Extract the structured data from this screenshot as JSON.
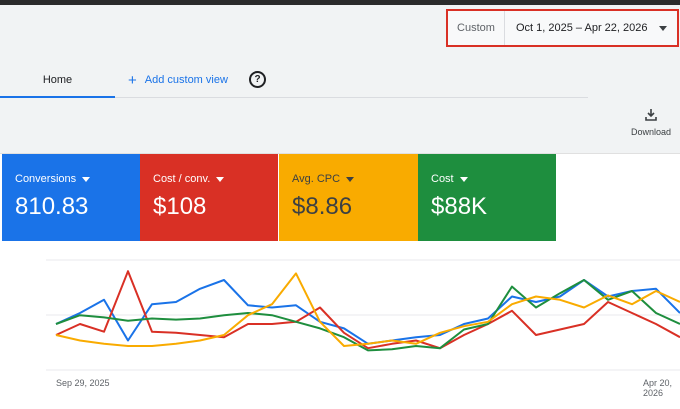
{
  "date_range": {
    "preset": "Custom",
    "range": "Oct 1, 2025 – Apr 22, 2026"
  },
  "tabs": {
    "home": "Home",
    "add_custom_view": "Add custom view"
  },
  "download": {
    "label": "Download"
  },
  "metric_cards": [
    {
      "label": "Conversions",
      "value": "810.83",
      "color": "#1a73e8"
    },
    {
      "label": "Cost / conv.",
      "value": "$108",
      "color": "#d93025"
    },
    {
      "label": "Avg. CPC",
      "value": "$8.86",
      "color": "#f9ab00"
    },
    {
      "label": "Cost",
      "value": "$88K",
      "color": "#1e8e3e"
    }
  ],
  "chart_data": {
    "type": "line",
    "x_start_label": "Sep 29, 2025",
    "x_end_label": "Apr 20, 2026",
    "y_range": [
      0,
      1
    ],
    "grid": true,
    "series": [
      {
        "color": "#1a73e8",
        "values": [
          0.4,
          0.5,
          0.62,
          0.25,
          0.58,
          0.6,
          0.72,
          0.8,
          0.57,
          0.55,
          0.57,
          0.42,
          0.36,
          0.22,
          0.25,
          0.28,
          0.3,
          0.4,
          0.45,
          0.65,
          0.6,
          0.65,
          0.8,
          0.65,
          0.7,
          0.72,
          0.5
        ]
      },
      {
        "color": "#d93025",
        "values": [
          0.3,
          0.4,
          0.33,
          0.88,
          0.33,
          0.32,
          0.3,
          0.28,
          0.4,
          0.4,
          0.42,
          0.55,
          0.32,
          0.18,
          0.22,
          0.25,
          0.18,
          0.3,
          0.4,
          0.52,
          0.3,
          0.35,
          0.4,
          0.6,
          0.5,
          0.4,
          0.28
        ]
      },
      {
        "color": "#1e8e3e",
        "values": [
          0.4,
          0.48,
          0.46,
          0.43,
          0.45,
          0.44,
          0.45,
          0.48,
          0.5,
          0.48,
          0.42,
          0.36,
          0.28,
          0.16,
          0.17,
          0.2,
          0.18,
          0.35,
          0.4,
          0.74,
          0.55,
          0.68,
          0.8,
          0.62,
          0.7,
          0.5,
          0.4
        ]
      },
      {
        "color": "#f9ab00",
        "values": [
          0.3,
          0.25,
          0.22,
          0.2,
          0.2,
          0.22,
          0.25,
          0.3,
          0.48,
          0.58,
          0.86,
          0.42,
          0.2,
          0.22,
          0.25,
          0.22,
          0.32,
          0.38,
          0.42,
          0.58,
          0.65,
          0.62,
          0.55,
          0.66,
          0.58,
          0.7,
          0.6
        ]
      }
    ]
  }
}
